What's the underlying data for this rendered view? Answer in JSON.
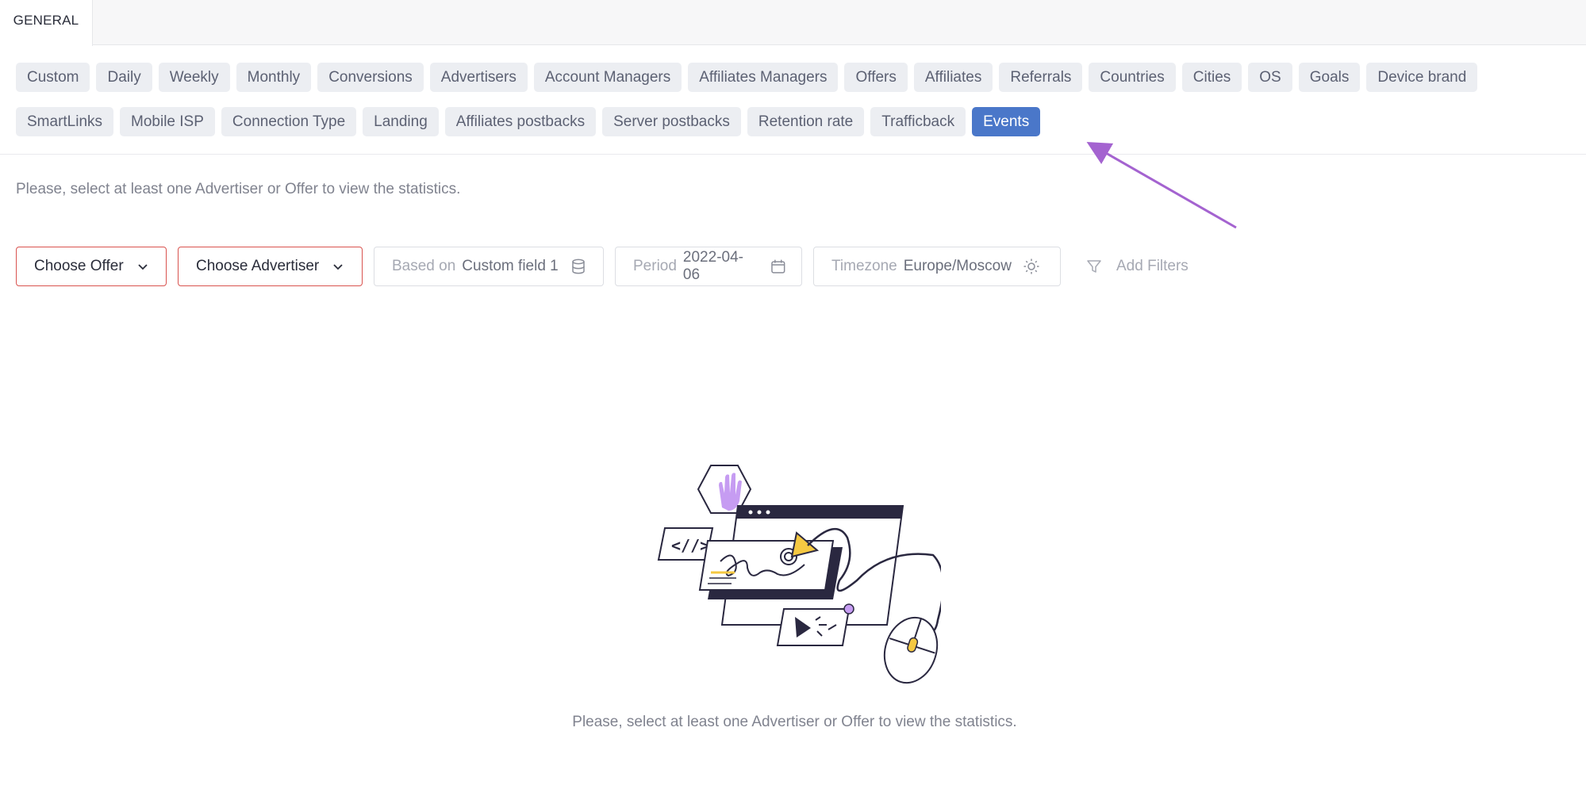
{
  "tabs": [
    {
      "label": "GENERAL",
      "active": true
    }
  ],
  "report_types": {
    "row1": [
      "Custom",
      "Daily",
      "Weekly",
      "Monthly",
      "Conversions",
      "Advertisers",
      "Account Managers",
      "Affiliates Managers",
      "Offers",
      "Affiliates",
      "Referrals",
      "Countries",
      "Cities",
      "OS",
      "Goals",
      "Device brand"
    ],
    "row2": [
      "SmartLinks",
      "Mobile ISP",
      "Connection Type",
      "Landing",
      "Affiliates postbacks",
      "Server postbacks",
      "Retention rate",
      "Trafficback",
      "Events"
    ],
    "active": "Events"
  },
  "hint_top": "Please, select at least one Advertiser or Offer to view the statistics.",
  "filters": {
    "choose_offer": "Choose Offer",
    "choose_advertiser": "Choose Advertiser",
    "based_on_label": "Based on",
    "based_on_value": "Custom field 1",
    "period_label": "Period",
    "period_value": "2022-04-06",
    "timezone_label": "Timezone",
    "timezone_value": "Europe/Moscow",
    "add_filters": "Add Filters"
  },
  "icons": {
    "chevron": "chevron-down-icon",
    "database": "database-icon",
    "calendar": "calendar-icon",
    "sun": "sun-icon",
    "filter": "filter-icon"
  },
  "colors": {
    "active_chip": "#4a77c9",
    "required_border": "#d9534f",
    "annotation_arrow": "#a463d0",
    "illustration_accent_yellow": "#f5c842",
    "illustration_accent_purple": "#c69cf2"
  },
  "hint_bottom": "Please, select at least one Advertiser or Offer to view the statistics."
}
